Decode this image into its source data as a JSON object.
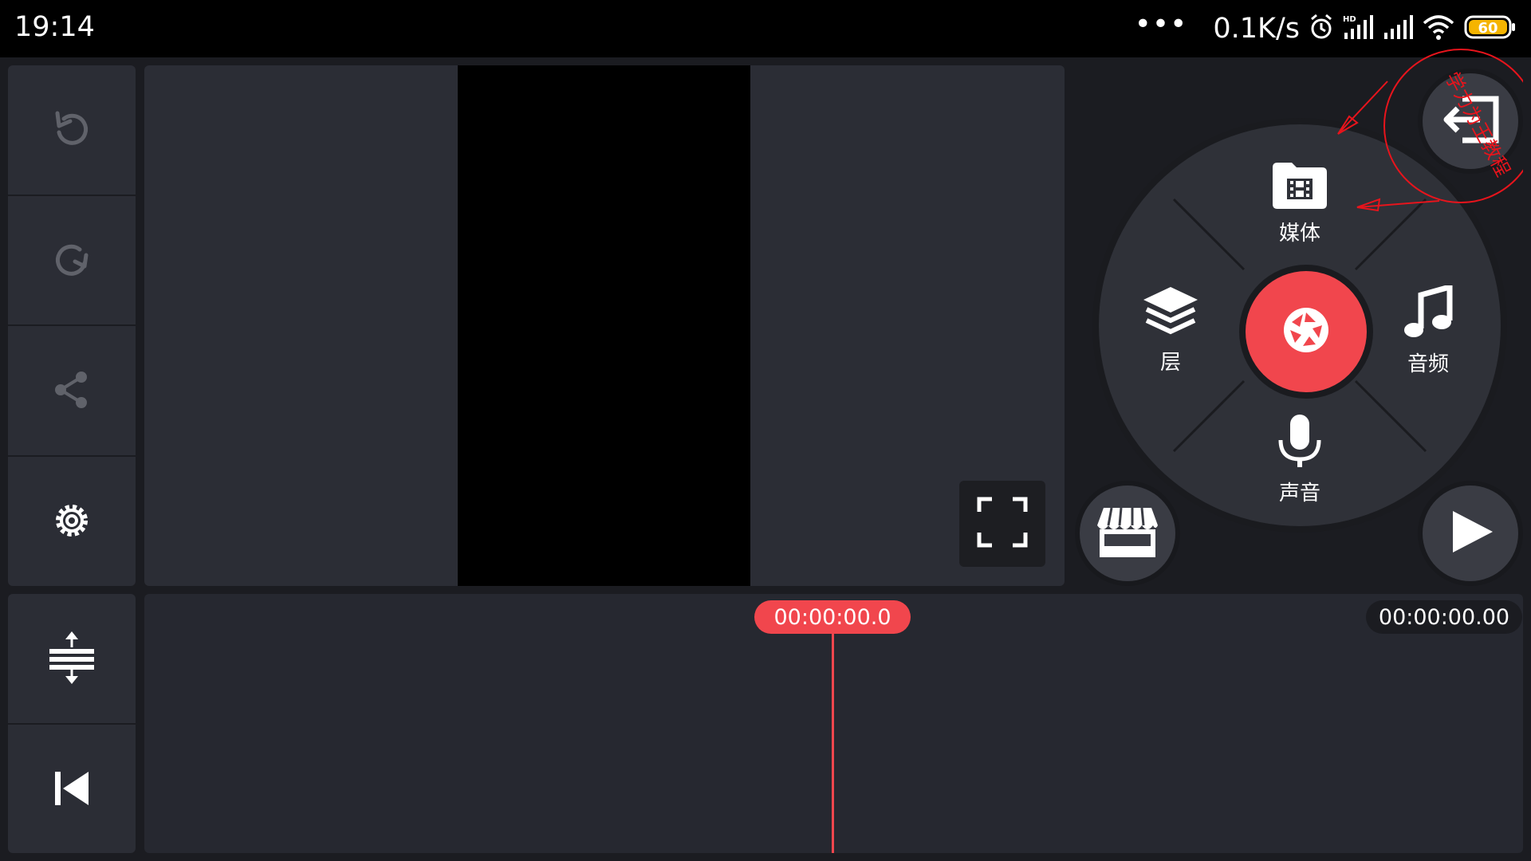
{
  "status_bar": {
    "time": "19:14",
    "dots": "•••",
    "speed": "0.1K/s",
    "battery": "60",
    "icons": [
      "alarm-icon",
      "hd-signal-icon",
      "signal-icon",
      "wifi-icon",
      "battery-icon"
    ]
  },
  "toolbar": {
    "items": [
      "undo-icon",
      "redo-icon",
      "share-icon",
      "settings-icon"
    ],
    "bottom_items": [
      "expand-timeline-icon",
      "skip-to-start-icon"
    ]
  },
  "radial_menu": {
    "media_label": "媒体",
    "layer_label": "层",
    "audio_label": "音频",
    "voice_label": "声音"
  },
  "annotation": {
    "text": "学力为王教程"
  },
  "timeline": {
    "current_time": "00:00:00.0",
    "total_time": "00:00:00.00"
  },
  "colors": {
    "accent": "#f1464d",
    "panel": "#2b2d35",
    "background": "#1b1c21",
    "annotation": "#e8141c"
  }
}
